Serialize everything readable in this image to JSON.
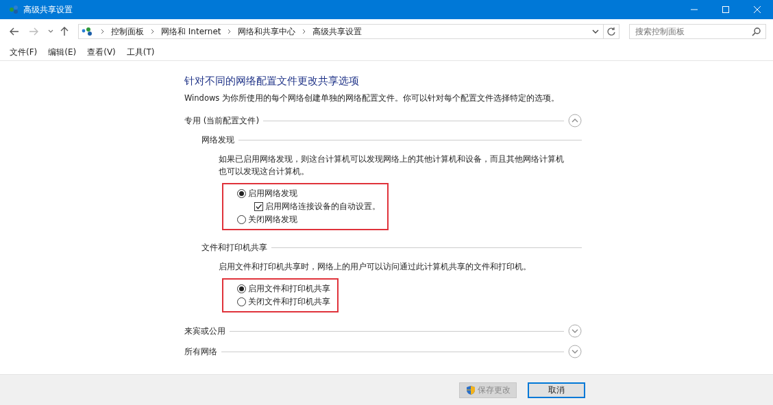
{
  "window": {
    "title": "高级共享设置"
  },
  "breadcrumb": [
    "控制面板",
    "网络和 Internet",
    "网络和共享中心",
    "高级共享设置"
  ],
  "search": {
    "placeholder": "搜索控制面板"
  },
  "menu": [
    "文件(F)",
    "编辑(E)",
    "查看(V)",
    "工具(T)"
  ],
  "heading": "针对不同的网络配置文件更改共享选项",
  "intro": "Windows 为你所使用的每个网络创建单独的网络配置文件。你可以针对每个配置文件选择特定的选项。",
  "sections": [
    {
      "title": "专用 (当前配置文件)",
      "expanded": true,
      "groups": [
        {
          "title": "网络发现",
          "description": "如果已启用网络发现，则这台计算机可以发现网络上的其他计算机和设备，而且其他网络计算机也可以发现这台计算机。",
          "highlighted": true,
          "options": [
            {
              "kind": "radio",
              "label": "启用网络发现",
              "selected": true
            },
            {
              "kind": "checkbox",
              "label": "启用网络连接设备的自动设置。",
              "checked": true
            },
            {
              "kind": "radio",
              "label": "关闭网络发现",
              "selected": false
            }
          ]
        },
        {
          "title": "文件和打印机共享",
          "description": "启用文件和打印机共享时，网络上的用户可以访问通过此计算机共享的文件和打印机。",
          "highlighted": true,
          "options": [
            {
              "kind": "radio",
              "label": "启用文件和打印机共享",
              "selected": true
            },
            {
              "kind": "radio",
              "label": "关闭文件和打印机共享",
              "selected": false
            }
          ]
        }
      ]
    },
    {
      "title": "来宾或公用",
      "expanded": false
    },
    {
      "title": "所有网络",
      "expanded": false
    }
  ],
  "buttons": [
    {
      "label": "保存更改",
      "disabled": true,
      "shield": true,
      "default": false
    },
    {
      "label": "取消",
      "disabled": false,
      "shield": false,
      "default": true
    }
  ]
}
